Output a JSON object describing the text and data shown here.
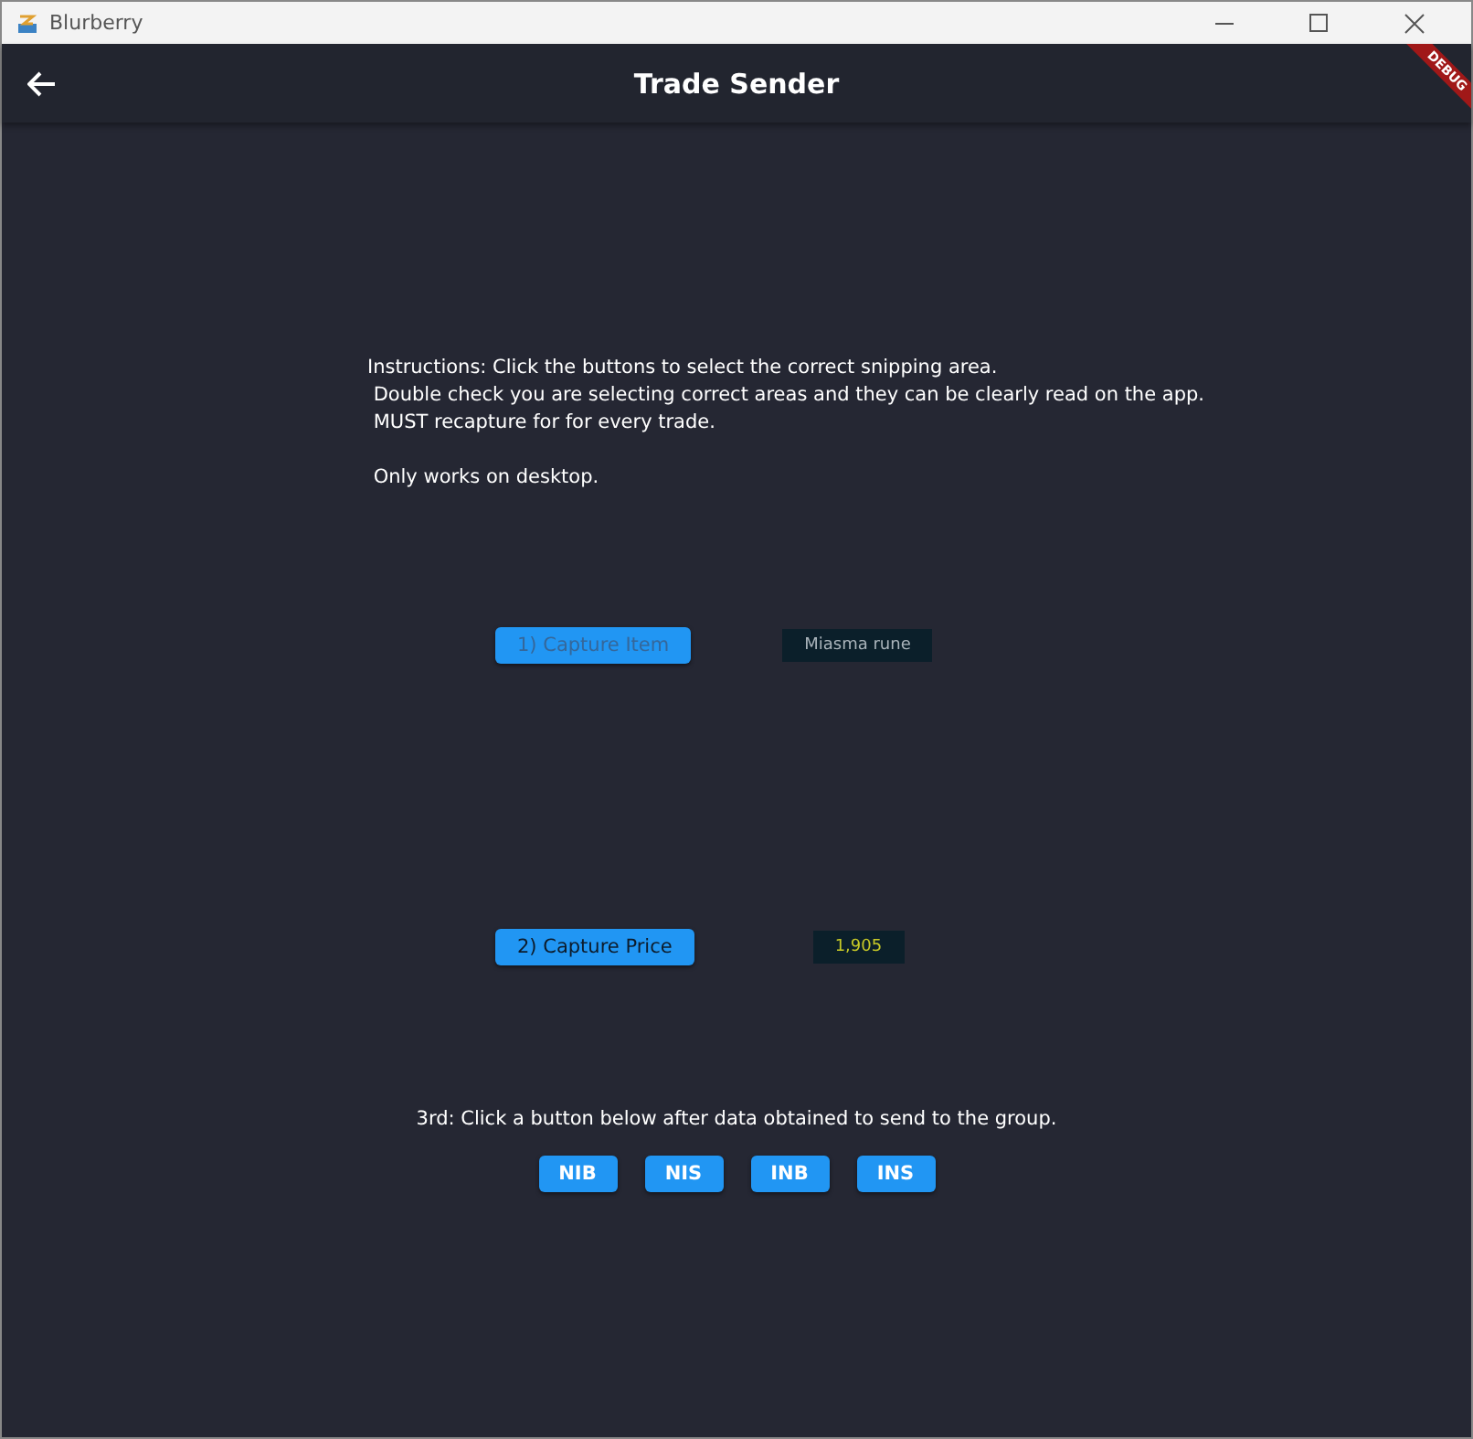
{
  "window": {
    "title": "Blurberry"
  },
  "app_bar": {
    "title": "Trade Sender",
    "debug_banner": "DEBUG"
  },
  "instructions": [
    "Instructions: Click the buttons to select the correct snipping area.",
    " Double check you are selecting correct areas and they can be clearly read on the app.",
    " MUST recapture for for every trade."
  ],
  "note": " Only works on desktop.",
  "captures": [
    {
      "button": "1) Capture Item",
      "value": "Miasma rune",
      "kind": "item"
    },
    {
      "button": "2) Capture Price",
      "value": "1,905",
      "kind": "price"
    }
  ],
  "send_prompt": "3rd: Click a button below after data obtained to send to the group.",
  "send_buttons": [
    "NIB",
    "NIS",
    "INB",
    "INS"
  ]
}
